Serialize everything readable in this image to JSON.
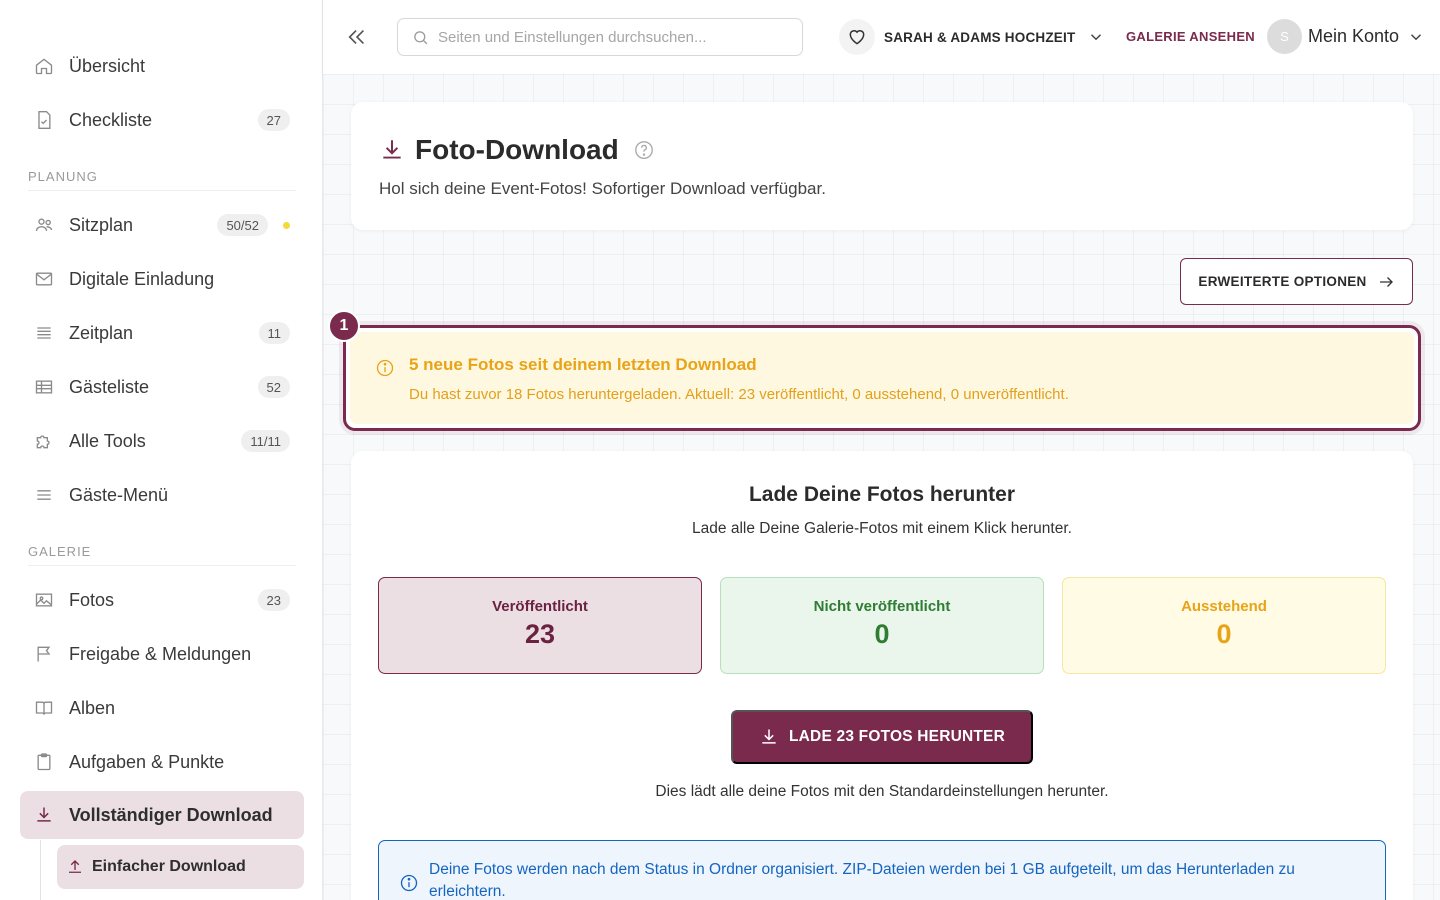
{
  "sidebar": {
    "items": [
      {
        "label": "Übersicht",
        "icon": "home-icon"
      },
      {
        "label": "Checkliste",
        "icon": "checklist-icon",
        "badge": "27"
      },
      {
        "label": "Sitzplan",
        "icon": "users-icon",
        "badge": "50/52"
      },
      {
        "label": "Digitale Einladung",
        "icon": "mail-icon"
      },
      {
        "label": "Zeitplan",
        "icon": "list-icon",
        "badge": "11"
      },
      {
        "label": "Gästeliste",
        "icon": "table-icon",
        "badge": "52"
      },
      {
        "label": "Alle Tools",
        "icon": "puzzle-icon",
        "badge": "11/11"
      },
      {
        "label": "Gäste-Menü",
        "icon": "menu-icon"
      },
      {
        "label": "Fotos",
        "icon": "image-icon",
        "badge": "23"
      },
      {
        "label": "Freigabe & Meldungen",
        "icon": "flag-icon"
      },
      {
        "label": "Alben",
        "icon": "book-icon"
      },
      {
        "label": "Aufgaben & Punkte",
        "icon": "clipboard-icon"
      },
      {
        "label": "Vollständiger Download",
        "icon": "download-icon"
      }
    ],
    "sub_item": {
      "label": "Einfacher Download",
      "icon": "upload-icon"
    },
    "sections": {
      "planung": "PLANUNG",
      "galerie": "GALERIE"
    }
  },
  "header": {
    "search_placeholder": "Seiten und Einstellungen durchsuchen...",
    "event_name": "SARAH & ADAMS HOCHZEIT",
    "gallery_link": "GALERIE ANSEHEN",
    "avatar_initial": "S",
    "account_label": "Mein Konto"
  },
  "page": {
    "title": "Foto-Download",
    "subtitle": "Hol sich deine Event-Fotos! Sofortiger Download verfügbar.",
    "advanced_button": "ERWEITERTE OPTIONEN"
  },
  "notice": {
    "step": "1",
    "title": "5 neue Fotos seit deinem letzten Download",
    "text": "Du hast zuvor 18 Fotos heruntergeladen. Aktuell: 23 veröffentlicht, 0 ausstehend, 0 unveröffentlicht."
  },
  "download": {
    "title": "Lade Deine Fotos herunter",
    "subtitle": "Lade alle Deine Galerie-Fotos mit einem Klick herunter.",
    "stats": {
      "published": {
        "label": "Veröffentlicht",
        "value": "23"
      },
      "unpublished": {
        "label": "Nicht veröffentlicht",
        "value": "0"
      },
      "pending": {
        "label": "Ausstehend",
        "value": "0"
      }
    },
    "button": "LADE 23 FOTOS HERUNTER",
    "note": "Dies lädt alle deine Fotos mit den Standardeinstellungen herunter.",
    "info": "Deine Fotos werden nach dem Status in Ordner organisiert. ZIP-Dateien werden bei 1 GB aufgeteilt, um das Herunterladen zu erleichtern."
  },
  "colors": {
    "accent": "#7a2a4c",
    "warning": "#e8a317",
    "success": "#2e7d32",
    "info": "#1565c0"
  }
}
